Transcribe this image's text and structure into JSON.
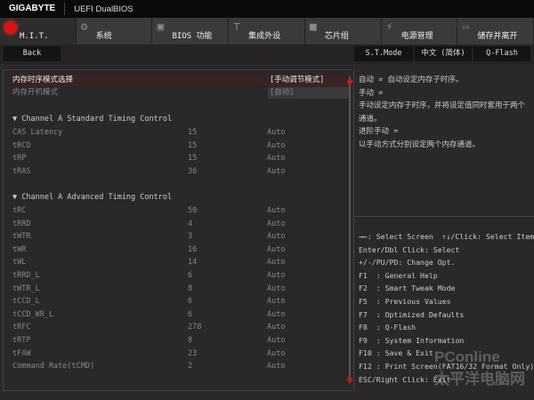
{
  "header": {
    "brand": "GIGABYTE",
    "title": "UEFI DualBIOS"
  },
  "tabs": [
    {
      "label": "M.I.T.",
      "icon": "mit-icon"
    },
    {
      "label": "系统",
      "icon": "gear-icon"
    },
    {
      "label": "BIOS 功能",
      "icon": "bios-icon"
    },
    {
      "label": "集成外设",
      "icon": "peripherals-icon"
    },
    {
      "label": "芯片组",
      "icon": "chipset-icon"
    },
    {
      "label": "电源管理",
      "icon": "power-icon"
    },
    {
      "label": "储存并离开",
      "icon": "exit-icon"
    }
  ],
  "toolbar": {
    "back": "Back",
    "st_mode": "S.T.Mode",
    "language": "中文 (简体)",
    "qflash": "Q-Flash"
  },
  "settings": {
    "timing_mode": {
      "label": "内存时序模式选择",
      "value": "[手动调节模式]"
    },
    "boot_mode": {
      "label": "内存开机模式",
      "value": "[自动]"
    },
    "standard_header": "▼ Channel A Standard Timing Control",
    "standard": [
      {
        "name": "CAS Latency",
        "value": "15",
        "mode": "Auto"
      },
      {
        "name": "tRCD",
        "value": "15",
        "mode": "Auto"
      },
      {
        "name": "tRP",
        "value": "15",
        "mode": "Auto"
      },
      {
        "name": "tRAS",
        "value": "36",
        "mode": "Auto"
      }
    ],
    "advanced_header": "▼ Channel A Advanced Timing Control",
    "advanced": [
      {
        "name": "tRC",
        "value": "50",
        "mode": "Auto"
      },
      {
        "name": "tRRD",
        "value": "4",
        "mode": "Auto"
      },
      {
        "name": "tWTR",
        "value": "3",
        "mode": "Auto"
      },
      {
        "name": "tWR",
        "value": "16",
        "mode": "Auto"
      },
      {
        "name": "tWL",
        "value": "14",
        "mode": "Auto"
      },
      {
        "name": "tRRD_L",
        "value": "6",
        "mode": "Auto"
      },
      {
        "name": "tWTR_L",
        "value": "8",
        "mode": "Auto"
      },
      {
        "name": "tCCD_L",
        "value": "6",
        "mode": "Auto"
      },
      {
        "name": "tCCD_WR_L",
        "value": "6",
        "mode": "Auto"
      },
      {
        "name": "tRFC",
        "value": "278",
        "mode": "Auto"
      },
      {
        "name": "tRTP",
        "value": "8",
        "mode": "Auto"
      },
      {
        "name": "tFAW",
        "value": "23",
        "mode": "Auto"
      },
      {
        "name": "Command Rate(tCMD)",
        "value": "2",
        "mode": "Auto"
      }
    ]
  },
  "help": [
    "自动 = 自动设定内存子时序。",
    "手动 =",
    "手动设定内存子时序，并将设定值同时套用于两个通道。",
    "进阶手动 =",
    "以手动方式分别设定两个内存通道。"
  ],
  "keys": [
    "→←: Select Screen  ↑↓/Click: Select Item",
    "Enter/Dbl Click: Select",
    "+/-/PU/PD: Change Opt.",
    "F1  : General Help",
    "F2  : Smart Tweak Mode",
    "F5  : Previous Values",
    "F7  : Optimized Defaults",
    "F8  : Q-Flash",
    "F9  : System Information",
    "F10 : Save & Exit",
    "F12 : Print Screen(FAT16/32 Format Only)",
    "ESC/Right Click: Exit"
  ],
  "watermark": "PConline 太平洋电脑网",
  "colors": {
    "accent": "#e01010",
    "background": "#2a2828"
  }
}
